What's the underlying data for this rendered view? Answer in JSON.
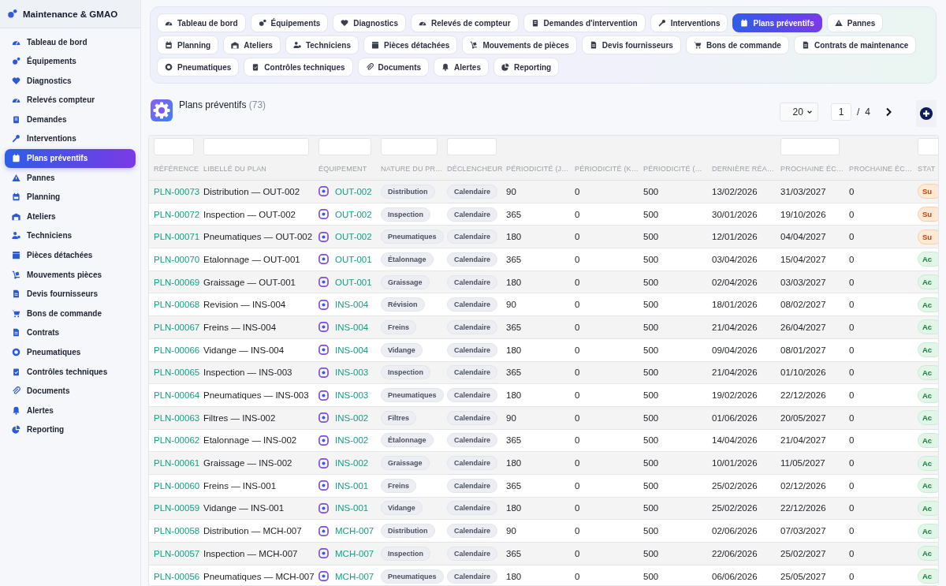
{
  "app": {
    "title": "Maintenance & GMAO"
  },
  "sidebar": {
    "items": [
      {
        "label": "Tableau de bord",
        "selected": false
      },
      {
        "label": "Équipements",
        "selected": false
      },
      {
        "label": "Diagnostics",
        "selected": false
      },
      {
        "label": "Relevés compteur",
        "selected": false
      },
      {
        "label": "Demandes",
        "selected": false
      },
      {
        "label": "Interventions",
        "selected": false
      },
      {
        "label": "Plans préventifs",
        "selected": true
      },
      {
        "label": "Pannes",
        "selected": false
      },
      {
        "label": "Planning",
        "selected": false
      },
      {
        "label": "Ateliers",
        "selected": false
      },
      {
        "label": "Techniciens",
        "selected": false
      },
      {
        "label": "Pièces détachées",
        "selected": false
      },
      {
        "label": "Mouvements pièces",
        "selected": false
      },
      {
        "label": "Devis fournisseurs",
        "selected": false
      },
      {
        "label": "Bons de commande",
        "selected": false
      },
      {
        "label": "Contrats",
        "selected": false
      },
      {
        "label": "Pneumatiques",
        "selected": false
      },
      {
        "label": "Contrôles techniques",
        "selected": false
      },
      {
        "label": "Documents",
        "selected": false
      },
      {
        "label": "Alertes",
        "selected": false
      },
      {
        "label": "Reporting",
        "selected": false
      }
    ]
  },
  "tabs": [
    {
      "label": "Tableau de bord",
      "selected": false
    },
    {
      "label": "Équipements",
      "selected": false
    },
    {
      "label": "Diagnostics",
      "selected": false
    },
    {
      "label": "Relevés de compteur",
      "selected": false
    },
    {
      "label": "Demandes d'intervention",
      "selected": false
    },
    {
      "label": "Interventions",
      "selected": false
    },
    {
      "label": "Plans préventifs",
      "selected": true
    },
    {
      "label": "Pannes",
      "selected": false
    },
    {
      "label": "Planning",
      "selected": false
    },
    {
      "label": "Ateliers",
      "selected": false
    },
    {
      "label": "Techniciens",
      "selected": false
    },
    {
      "label": "Pièces détachées",
      "selected": false
    },
    {
      "label": "Mouvements de pièces",
      "selected": false
    },
    {
      "label": "Devis fournisseurs",
      "selected": false
    },
    {
      "label": "Bons de commande",
      "selected": false
    },
    {
      "label": "Contrats de maintenance",
      "selected": false
    },
    {
      "label": "Pneumatiques",
      "selected": false
    },
    {
      "label": "Contrôles techniques",
      "selected": false
    },
    {
      "label": "Documents",
      "selected": false
    },
    {
      "label": "Alertes",
      "selected": false
    },
    {
      "label": "Reporting",
      "selected": false
    }
  ],
  "header": {
    "title": "Plans préventifs",
    "count": "(73)",
    "page_size": "20",
    "page": "1",
    "separator": "/",
    "total_pages": "4"
  },
  "table": {
    "columns": [
      {
        "label": "RÉFÉRENCE",
        "filter": true
      },
      {
        "label": "LIBELLÉ DU PLAN",
        "filter": true
      },
      {
        "label": "ÉQUIPEMENT",
        "filter": true
      },
      {
        "label": "NATURE DU PR…",
        "filter": true
      },
      {
        "label": "DÉCLENCHEUR",
        "filter": true
      },
      {
        "label": "PÉRIODICITÉ (J…",
        "filter": false
      },
      {
        "label": "PÉRIODICITÉ (K…",
        "filter": false
      },
      {
        "label": "PÉRIODICITÉ (…",
        "filter": false
      },
      {
        "label": "DERNIÈRE RÉA…",
        "filter": false
      },
      {
        "label": "PROCHAINE ÉC…",
        "filter": true
      },
      {
        "label": "PROCHAINE ÉC…",
        "filter": false
      },
      {
        "label": "STAT",
        "filter": true
      }
    ],
    "rows": [
      {
        "ref": "PLN-00073",
        "label": "Distribution — OUT-002",
        "equipment": "OUT-002",
        "nature": "Distribution",
        "trigger": "Calendaire",
        "period_1": "90",
        "period_2": "0",
        "period_3": "500",
        "last": "13/02/2026",
        "next": "31/03/2027",
        "next_2": "0",
        "status": {
          "text": "Su",
          "kind": "suspended"
        }
      },
      {
        "ref": "PLN-00072",
        "label": "Inspection — OUT-002",
        "equipment": "OUT-002",
        "nature": "Inspection",
        "trigger": "Calendaire",
        "period_1": "365",
        "period_2": "0",
        "period_3": "500",
        "last": "30/01/2026",
        "next": "19/10/2026",
        "next_2": "0",
        "status": {
          "text": "Su",
          "kind": "suspended"
        }
      },
      {
        "ref": "PLN-00071",
        "label": "Pneumatiques — OUT-002",
        "equipment": "OUT-002",
        "nature": "Pneumatiques",
        "trigger": "Calendaire",
        "period_1": "180",
        "period_2": "0",
        "period_3": "500",
        "last": "12/01/2026",
        "next": "04/04/2027",
        "next_2": "0",
        "status": {
          "text": "Su",
          "kind": "suspended"
        }
      },
      {
        "ref": "PLN-00070",
        "label": "Etalonnage — OUT-001",
        "equipment": "OUT-001",
        "nature": "Étalonnage",
        "trigger": "Calendaire",
        "period_1": "365",
        "period_2": "0",
        "period_3": "500",
        "last": "03/04/2026",
        "next": "15/04/2027",
        "next_2": "0",
        "status": {
          "text": "Ac",
          "kind": "active"
        }
      },
      {
        "ref": "PLN-00069",
        "label": "Graissage — OUT-001",
        "equipment": "OUT-001",
        "nature": "Graissage",
        "trigger": "Calendaire",
        "period_1": "180",
        "period_2": "0",
        "period_3": "500",
        "last": "02/04/2026",
        "next": "03/03/2027",
        "next_2": "0",
        "status": {
          "text": "Ac",
          "kind": "active"
        }
      },
      {
        "ref": "PLN-00068",
        "label": "Revision — INS-004",
        "equipment": "INS-004",
        "nature": "Révision",
        "trigger": "Calendaire",
        "period_1": "90",
        "period_2": "0",
        "period_3": "500",
        "last": "18/01/2026",
        "next": "08/02/2027",
        "next_2": "0",
        "status": {
          "text": "Ac",
          "kind": "active"
        }
      },
      {
        "ref": "PLN-00067",
        "label": "Freins — INS-004",
        "equipment": "INS-004",
        "nature": "Freins",
        "trigger": "Calendaire",
        "period_1": "365",
        "period_2": "0",
        "period_3": "500",
        "last": "21/04/2026",
        "next": "26/04/2027",
        "next_2": "0",
        "status": {
          "text": "Ac",
          "kind": "active"
        }
      },
      {
        "ref": "PLN-00066",
        "label": "Vidange — INS-004",
        "equipment": "INS-004",
        "nature": "Vidange",
        "trigger": "Calendaire",
        "period_1": "180",
        "period_2": "0",
        "period_3": "500",
        "last": "09/04/2026",
        "next": "08/01/2027",
        "next_2": "0",
        "status": {
          "text": "Ac",
          "kind": "active"
        }
      },
      {
        "ref": "PLN-00065",
        "label": "Inspection — INS-003",
        "equipment": "INS-003",
        "nature": "Inspection",
        "trigger": "Calendaire",
        "period_1": "365",
        "period_2": "0",
        "period_3": "500",
        "last": "21/04/2026",
        "next": "01/10/2026",
        "next_2": "0",
        "status": {
          "text": "Ac",
          "kind": "active"
        }
      },
      {
        "ref": "PLN-00064",
        "label": "Pneumatiques — INS-003",
        "equipment": "INS-003",
        "nature": "Pneumatiques",
        "trigger": "Calendaire",
        "period_1": "180",
        "period_2": "0",
        "period_3": "500",
        "last": "19/02/2026",
        "next": "22/12/2026",
        "next_2": "0",
        "status": {
          "text": "Ac",
          "kind": "active"
        }
      },
      {
        "ref": "PLN-00063",
        "label": "Filtres — INS-002",
        "equipment": "INS-002",
        "nature": "Filtres",
        "trigger": "Calendaire",
        "period_1": "90",
        "period_2": "0",
        "period_3": "500",
        "last": "01/06/2026",
        "next": "20/05/2027",
        "next_2": "0",
        "status": {
          "text": "Ac",
          "kind": "active"
        }
      },
      {
        "ref": "PLN-00062",
        "label": "Etalonnage — INS-002",
        "equipment": "INS-002",
        "nature": "Étalonnage",
        "trigger": "Calendaire",
        "period_1": "365",
        "period_2": "0",
        "period_3": "500",
        "last": "14/04/2026",
        "next": "21/04/2027",
        "next_2": "0",
        "status": {
          "text": "Ac",
          "kind": "active"
        }
      },
      {
        "ref": "PLN-00061",
        "label": "Graissage — INS-002",
        "equipment": "INS-002",
        "nature": "Graissage",
        "trigger": "Calendaire",
        "period_1": "180",
        "period_2": "0",
        "period_3": "500",
        "last": "10/01/2026",
        "next": "11/05/2027",
        "next_2": "0",
        "status": {
          "text": "Ac",
          "kind": "active"
        }
      },
      {
        "ref": "PLN-00060",
        "label": "Freins — INS-001",
        "equipment": "INS-001",
        "nature": "Freins",
        "trigger": "Calendaire",
        "period_1": "365",
        "period_2": "0",
        "period_3": "500",
        "last": "25/02/2026",
        "next": "02/12/2026",
        "next_2": "0",
        "status": {
          "text": "Ac",
          "kind": "active"
        }
      },
      {
        "ref": "PLN-00059",
        "label": "Vidange — INS-001",
        "equipment": "INS-001",
        "nature": "Vidange",
        "trigger": "Calendaire",
        "period_1": "180",
        "period_2": "0",
        "period_3": "500",
        "last": "25/02/2026",
        "next": "22/12/2026",
        "next_2": "0",
        "status": {
          "text": "Ac",
          "kind": "active"
        }
      },
      {
        "ref": "PLN-00058",
        "label": "Distribution — MCH-007",
        "equipment": "MCH-007",
        "nature": "Distribution",
        "trigger": "Calendaire",
        "period_1": "90",
        "period_2": "0",
        "period_3": "500",
        "last": "02/06/2026",
        "next": "07/03/2027",
        "next_2": "0",
        "status": {
          "text": "Ac",
          "kind": "active"
        }
      },
      {
        "ref": "PLN-00057",
        "label": "Inspection — MCH-007",
        "equipment": "MCH-007",
        "nature": "Inspection",
        "trigger": "Calendaire",
        "period_1": "365",
        "period_2": "0",
        "period_3": "500",
        "last": "22/06/2026",
        "next": "25/02/2027",
        "next_2": "0",
        "status": {
          "text": "Ac",
          "kind": "active"
        }
      },
      {
        "ref": "PLN-00056",
        "label": "Pneumatiques — MCH-007",
        "equipment": "MCH-007",
        "nature": "Pneumatiques",
        "trigger": "Calendaire",
        "period_1": "180",
        "period_2": "0",
        "period_3": "500",
        "last": "06/06/2026",
        "next": "25/05/2027",
        "next_2": "0",
        "status": {
          "text": "Ac",
          "kind": "active"
        }
      }
    ]
  }
}
